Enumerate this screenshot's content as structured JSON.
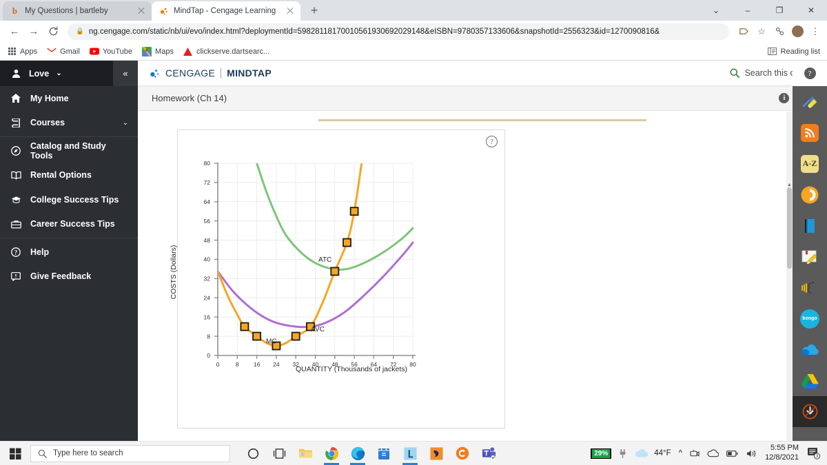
{
  "browser": {
    "tabs": [
      {
        "title": "My Questions | bartleby",
        "favicon": "bartleby-b-icon",
        "active": false
      },
      {
        "title": "MindTap - Cengage Learning",
        "favicon": "cengage-spark-icon",
        "active": true
      }
    ],
    "new_tab_label": "+",
    "window_controls": {
      "restore": "⌄",
      "minimize": "–",
      "maximize": "❐",
      "close": "✕"
    },
    "url": "ng.cengage.com/static/nb/ui/evo/index.html?deploymentId=59828118170010561930692029148&eISBN=9780357133606&snapshotId=2556323&id=1270090816&",
    "back_label": "←",
    "forward_label": "→",
    "reload_label": "C",
    "bookmarks": [
      {
        "label": "Apps",
        "icon": "apps-grid-icon"
      },
      {
        "label": "Gmail",
        "icon": "gmail-icon"
      },
      {
        "label": "YouTube",
        "icon": "youtube-icon"
      },
      {
        "label": "Maps",
        "icon": "google-maps-icon"
      },
      {
        "label": "clickserve.dartsearc...",
        "icon": "adobe-a-icon"
      }
    ],
    "reading_list": "Reading list"
  },
  "leftnav": {
    "user": "Love",
    "user_icon": "person-icon",
    "user_chevron": "⌄",
    "collapse_label": "«",
    "items": [
      {
        "label": "My Home",
        "icon": "home-icon",
        "chevron": ""
      },
      {
        "label": "Courses",
        "icon": "book-icon",
        "chevron": "⌄"
      },
      {
        "label": "Catalog and Study Tools",
        "icon": "compass-icon",
        "chevron": ""
      },
      {
        "label": "Rental Options",
        "icon": "open-book-icon",
        "chevron": ""
      },
      {
        "label": "College Success Tips",
        "icon": "graduation-cap-icon",
        "chevron": ""
      },
      {
        "label": "Career Success Tips",
        "icon": "briefcase-icon",
        "chevron": ""
      },
      {
        "label": "Help",
        "icon": "question-circle-icon",
        "chevron": ""
      },
      {
        "label": "Give Feedback",
        "icon": "feedback-icon",
        "chevron": ""
      }
    ]
  },
  "mindtap": {
    "brand_cengage": "CENGAGE",
    "brand_mindtap": "MINDTAP",
    "search_label": "Search this course",
    "search_icon": "search-icon",
    "help_label": "?",
    "activity_title": "Homework (Ch 14)",
    "info_label": "i",
    "close_label": "✕",
    "card_help_label": "?"
  },
  "rail": {
    "help_label": "?",
    "items": [
      {
        "name": "highlighter-icon",
        "label": ""
      },
      {
        "name": "rss-feed-icon",
        "label": ""
      },
      {
        "name": "dictionary-az-icon",
        "label": "A-Z"
      },
      {
        "name": "mindtap-mobile-icon",
        "label": ""
      },
      {
        "name": "ebook-icon",
        "label": ""
      },
      {
        "name": "notepad-pencil-icon",
        "label": ""
      },
      {
        "name": "read-aloud-icon",
        "label": ""
      },
      {
        "name": "bongo-icon",
        "label": "bongo"
      },
      {
        "name": "onedrive-icon",
        "label": ""
      },
      {
        "name": "google-drive-icon",
        "label": ""
      },
      {
        "name": "download-icon",
        "label": ""
      }
    ]
  },
  "chart_data": {
    "type": "line",
    "title": "",
    "xlabel": "QUANTITY (Thousands of jackets)",
    "ylabel": "COSTS (Dollars)",
    "xlim": [
      0,
      80
    ],
    "ylim": [
      0,
      80
    ],
    "xticks": [
      0,
      8,
      16,
      24,
      32,
      40,
      48,
      56,
      64,
      72,
      80
    ],
    "yticks": [
      0,
      8,
      16,
      24,
      32,
      40,
      48,
      56,
      64,
      72,
      80
    ],
    "grid": true,
    "legend": "inline-labels",
    "series": [
      {
        "name": "MC",
        "label": "MC",
        "color": "#f5a623",
        "label_x": 22,
        "label_y": 5,
        "markers": [
          {
            "x": 11,
            "y": 12
          },
          {
            "x": 16,
            "y": 8
          },
          {
            "x": 24,
            "y": 4
          },
          {
            "x": 32,
            "y": 8
          },
          {
            "x": 38,
            "y": 12
          },
          {
            "x": 48,
            "y": 35
          },
          {
            "x": 53,
            "y": 47
          },
          {
            "x": 56,
            "y": 60
          }
        ],
        "curve": [
          {
            "x": 0,
            "y": 35
          },
          {
            "x": 4,
            "y": 25
          },
          {
            "x": 8,
            "y": 17
          },
          {
            "x": 11,
            "y": 12
          },
          {
            "x": 16,
            "y": 8
          },
          {
            "x": 20,
            "y": 5.2
          },
          {
            "x": 24,
            "y": 4
          },
          {
            "x": 28,
            "y": 5.2
          },
          {
            "x": 32,
            "y": 8
          },
          {
            "x": 38,
            "y": 12
          },
          {
            "x": 43,
            "y": 22
          },
          {
            "x": 48,
            "y": 35
          },
          {
            "x": 53,
            "y": 47
          },
          {
            "x": 56,
            "y": 60
          },
          {
            "x": 59,
            "y": 80
          }
        ]
      },
      {
        "name": "AVC",
        "label": "AVC",
        "color": "#b06ed0",
        "label_x": 41,
        "label_y": 10,
        "markers": [],
        "curve": [
          {
            "x": 0,
            "y": 35
          },
          {
            "x": 6,
            "y": 27
          },
          {
            "x": 12,
            "y": 21
          },
          {
            "x": 18,
            "y": 16.5
          },
          {
            "x": 24,
            "y": 13.6
          },
          {
            "x": 32,
            "y": 12
          },
          {
            "x": 38,
            "y": 12
          },
          {
            "x": 44,
            "y": 13.5
          },
          {
            "x": 52,
            "y": 18
          },
          {
            "x": 60,
            "y": 25
          },
          {
            "x": 68,
            "y": 33
          },
          {
            "x": 76,
            "y": 42
          },
          {
            "x": 80,
            "y": 47
          }
        ]
      },
      {
        "name": "ATC",
        "label": "ATC",
        "color": "#7cc576",
        "label_x": 44,
        "label_y": 39,
        "markers": [],
        "curve": [
          {
            "x": 16,
            "y": 80
          },
          {
            "x": 20,
            "y": 68
          },
          {
            "x": 24,
            "y": 58
          },
          {
            "x": 28,
            "y": 50
          },
          {
            "x": 34,
            "y": 43
          },
          {
            "x": 40,
            "y": 38.5
          },
          {
            "x": 47,
            "y": 36
          },
          {
            "x": 53,
            "y": 36
          },
          {
            "x": 60,
            "y": 38.5
          },
          {
            "x": 68,
            "y": 43
          },
          {
            "x": 76,
            "y": 49
          },
          {
            "x": 80,
            "y": 53
          }
        ]
      }
    ]
  },
  "taskbar": {
    "start_icon": "windows-start-icon",
    "search_placeholder": "Type here to search",
    "search_icon": "search-icon",
    "icons": [
      {
        "name": "cortana-icon",
        "running": false
      },
      {
        "name": "task-view-icon",
        "running": false
      },
      {
        "name": "file-explorer-icon",
        "running": false
      },
      {
        "name": "google-chrome-icon",
        "running": true
      },
      {
        "name": "microsoft-edge-icon",
        "running": true
      },
      {
        "name": "microsoft-store-icon",
        "running": false
      },
      {
        "name": "lockdown-browser-icon",
        "running": true
      },
      {
        "name": "zoom-like-orange-icon",
        "running": false
      },
      {
        "name": "cengage-c-icon",
        "running": false
      },
      {
        "name": "microsoft-teams-icon",
        "running": false
      }
    ],
    "battery_percent": "29%",
    "weather": "44°F",
    "time": "5:55 PM",
    "date": "12/8/2021",
    "notification_count": "3",
    "tray_icons": [
      "chevron-up-icon",
      "camera-icon",
      "onedrive-cloud-icon",
      "battery-icon",
      "volume-icon"
    ]
  }
}
